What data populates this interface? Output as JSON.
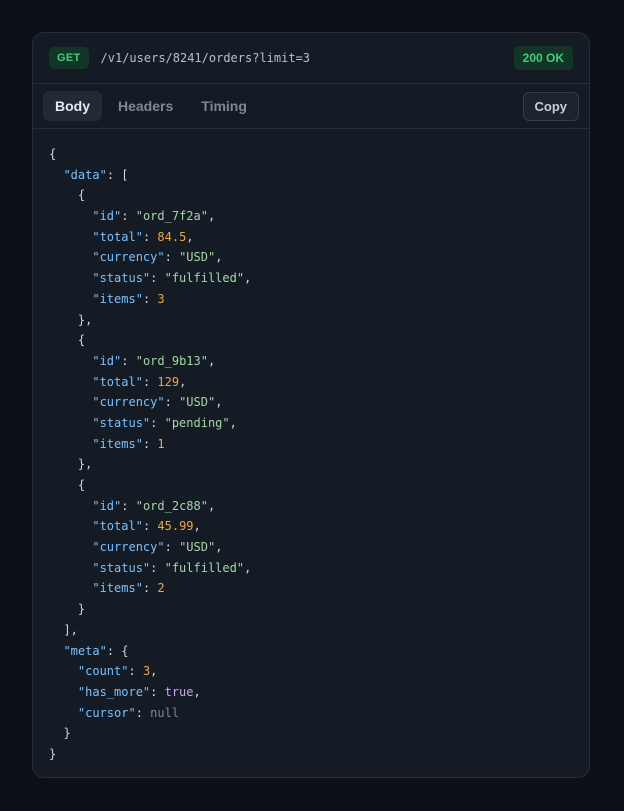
{
  "request": {
    "method": "GET",
    "url": "/v1/users/8241/orders?limit=3",
    "status": "200 OK"
  },
  "tabs": [
    {
      "label": "Body",
      "active": true
    },
    {
      "label": "Headers",
      "active": false
    },
    {
      "label": "Timing",
      "active": false
    }
  ],
  "copy_label": "Copy",
  "colors": {
    "key": "#79c0ff",
    "string": "#a5d6a7",
    "number": "#f0a545",
    "boolean": "#c9a2f7",
    "null": "#7d8796",
    "status_green": "#3fcf7e"
  },
  "response_body": {
    "data": [
      {
        "id": "ord_7f2a",
        "total": 84.5,
        "currency": "USD",
        "status": "fulfilled",
        "items": 3
      },
      {
        "id": "ord_9b13",
        "total": 129,
        "currency": "USD",
        "status": "pending",
        "items": 1
      },
      {
        "id": "ord_2c88",
        "total": 45.99,
        "currency": "USD",
        "status": "fulfilled",
        "items": 2
      }
    ],
    "meta": {
      "count": 3,
      "has_more": true,
      "cursor": null
    }
  }
}
